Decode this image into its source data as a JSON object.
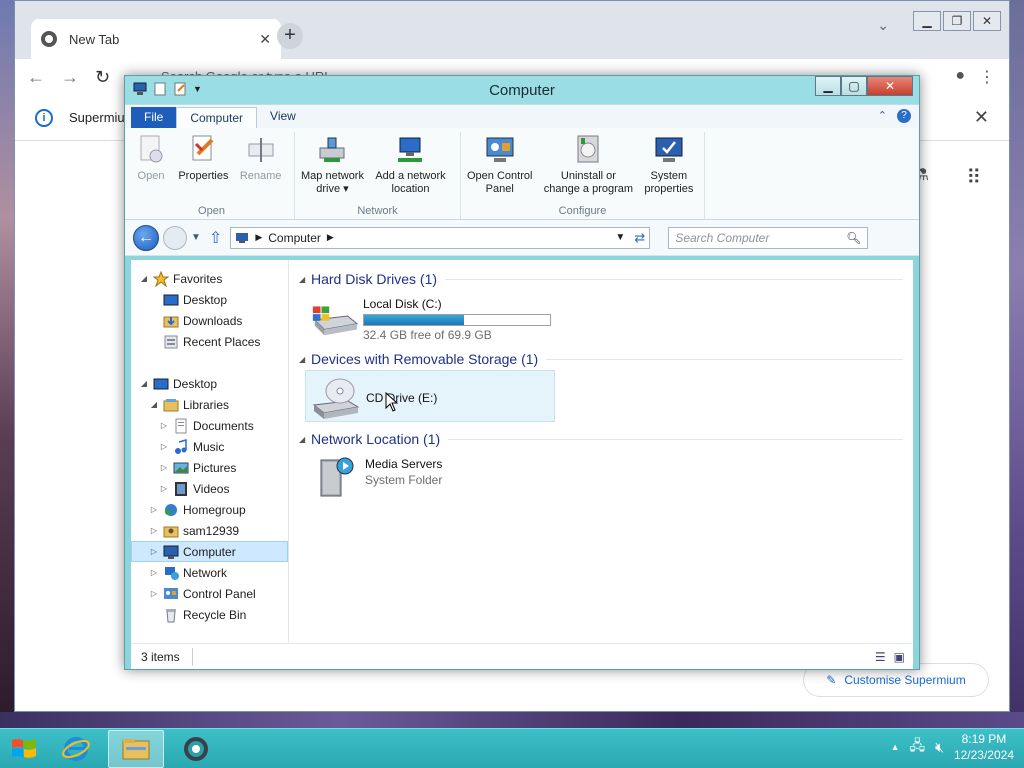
{
  "chrome": {
    "tab_title": "New Tab",
    "omnibox_placeholder": "Search Google or type a URL",
    "infobar_text": "Supermium",
    "customise_label": "Customise Supermium"
  },
  "explorer": {
    "title": "Computer",
    "ribbon_tabs": [
      "File",
      "Computer",
      "View"
    ],
    "groups": {
      "open": {
        "label": "Open",
        "buttons": {
          "open": "Open",
          "properties": "Properties",
          "rename": "Rename"
        }
      },
      "network": {
        "label": "Network",
        "buttons": {
          "map_drive_1": "Map network",
          "map_drive_2": "drive",
          "add_location_1": "Add a network",
          "add_location_2": "location"
        }
      },
      "configure": {
        "label": "Configure",
        "buttons": {
          "control_panel_1": "Open Control",
          "control_panel_2": "Panel",
          "uninstall_1": "Uninstall or",
          "uninstall_2": "change a program",
          "sysprops_1": "System",
          "sysprops_2": "properties"
        }
      }
    },
    "address": "Computer",
    "search_placeholder": "Search Computer",
    "nav": {
      "favorites": "Favorites",
      "desktop_fav": "Desktop",
      "downloads": "Downloads",
      "recent": "Recent Places",
      "desktop": "Desktop",
      "libraries": "Libraries",
      "documents": "Documents",
      "music": "Music",
      "pictures": "Pictures",
      "videos": "Videos",
      "homegroup": "Homegroup",
      "user": "sam12939",
      "computer": "Computer",
      "network": "Network",
      "control_panel": "Control Panel",
      "recycle_bin": "Recycle Bin"
    },
    "sections": {
      "hdd": "Hard Disk Drives (1)",
      "removable": "Devices with Removable Storage (1)",
      "netloc": "Network Location (1)"
    },
    "items": {
      "local_disk_name": "Local Disk (C:)",
      "local_disk_free": "32.4 GB free of 69.9 GB",
      "local_disk_used_fraction": 0.536,
      "cd_name": "CD Drive (E:)",
      "media_name": "Media Servers",
      "media_type": "System Folder"
    },
    "status": "3 items"
  },
  "taskbar": {
    "time": "8:19 PM",
    "date": "12/23/2024"
  }
}
